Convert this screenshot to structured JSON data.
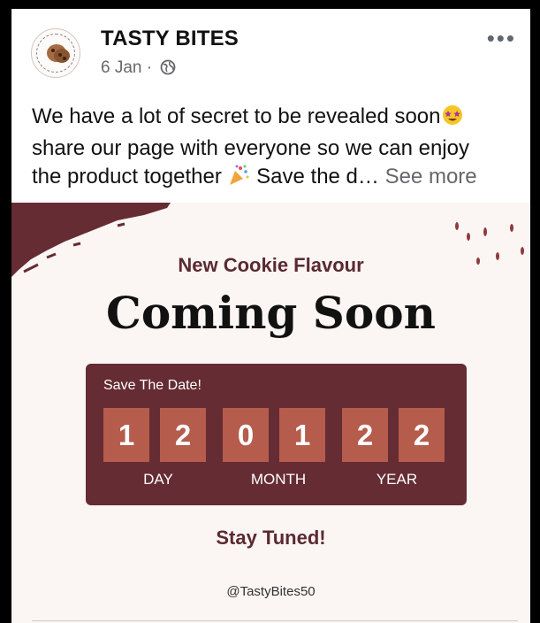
{
  "post": {
    "page_name": "TASTY BITES",
    "date": "6 Jan",
    "separator": "·",
    "more_label": "•••",
    "text_line1": "We have a lot of secret to be revealed soon",
    "text_line2": "share our page with everyone so we can enjoy",
    "text_line3": "the product together ",
    "text_line3b": " Save the d…",
    "see_more": "See more"
  },
  "graphic": {
    "subtitle": "New Cookie Flavour",
    "title": "Coming Soon",
    "save_label": "Save The Date!",
    "digits": [
      "1",
      "2",
      "0",
      "1",
      "2",
      "2"
    ],
    "units": [
      "DAY",
      "MONTH",
      "YEAR"
    ],
    "stay_tuned": "Stay Tuned!",
    "handle": "@TastyBites50"
  },
  "icons": {
    "avatar": "cookie-logo",
    "globe": "globe-icon",
    "emoji1": "star-struck-emoji",
    "emoji2": "party-popper-emoji"
  },
  "colors": {
    "accent_dark": "#652c33",
    "digit_tile": "#b55c4c",
    "heading": "#5a2a30",
    "background": "#fbf5f4"
  }
}
